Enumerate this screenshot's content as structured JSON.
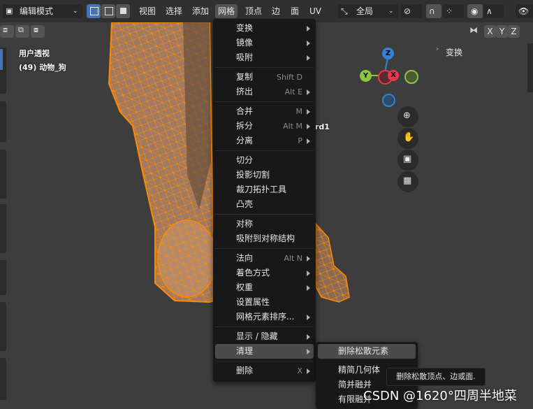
{
  "header": {
    "mode_label": "编辑模式",
    "menus": [
      "视图",
      "选择",
      "添加",
      "网格",
      "顶点",
      "边",
      "面",
      "UV"
    ],
    "active_menu": "网格",
    "orientation": "全局"
  },
  "subheader": {
    "axes": [
      "X",
      "Y",
      "Z"
    ]
  },
  "viewport": {
    "view_name": "用户透视",
    "object_info": "(49) 动物_狗",
    "partial_label": "rd1"
  },
  "gizmo": {
    "z": "Z",
    "y": "Y",
    "x": "X"
  },
  "sidebar": {
    "transform_label": "变换"
  },
  "mesh_menu": {
    "items": [
      {
        "label": "变换",
        "shortcut": "",
        "submenu": true
      },
      {
        "label": "镜像",
        "shortcut": "",
        "submenu": true
      },
      {
        "label": "吸附",
        "shortcut": "",
        "submenu": true
      },
      {
        "label": "复制",
        "shortcut": "Shift D",
        "submenu": false
      },
      {
        "label": "挤出",
        "shortcut": "Alt E",
        "submenu": true
      },
      {
        "label": "合并",
        "shortcut": "M",
        "submenu": true
      },
      {
        "label": "拆分",
        "shortcut": "Alt M",
        "submenu": true
      },
      {
        "label": "分离",
        "shortcut": "P",
        "submenu": true
      },
      {
        "label": "切分",
        "shortcut": "",
        "submenu": false
      },
      {
        "label": "投影切割",
        "shortcut": "",
        "submenu": false
      },
      {
        "label": "裁刀拓扑工具",
        "shortcut": "",
        "submenu": false
      },
      {
        "label": "凸壳",
        "shortcut": "",
        "submenu": false
      },
      {
        "label": "对称",
        "shortcut": "",
        "submenu": false
      },
      {
        "label": "吸附到对称结构",
        "shortcut": "",
        "submenu": false
      },
      {
        "label": "法向",
        "shortcut": "Alt N",
        "submenu": true
      },
      {
        "label": "着色方式",
        "shortcut": "",
        "submenu": true
      },
      {
        "label": "权重",
        "shortcut": "",
        "submenu": true
      },
      {
        "label": "设置属性",
        "shortcut": "",
        "submenu": false
      },
      {
        "label": "网格元素排序...",
        "shortcut": "",
        "submenu": true
      },
      {
        "label": "显示 / 隐藏",
        "shortcut": "",
        "submenu": true
      },
      {
        "label": "清理",
        "shortcut": "",
        "submenu": true
      },
      {
        "label": "删除",
        "shortcut": "X",
        "submenu": true
      }
    ]
  },
  "cleanup_menu": {
    "items": [
      "删除松散元素",
      "精简几何体",
      "简并融并",
      "有限融并"
    ]
  },
  "tooltip": "删除松散顶点、边或面.",
  "watermark": "CSDN @1620°四周半地菜",
  "colors": {
    "accent": "#4772b3",
    "mesh_orange": "#ff8a00",
    "axis_x": "#e8394c",
    "axis_y": "#8cc63f",
    "axis_z": "#2f83d8"
  }
}
